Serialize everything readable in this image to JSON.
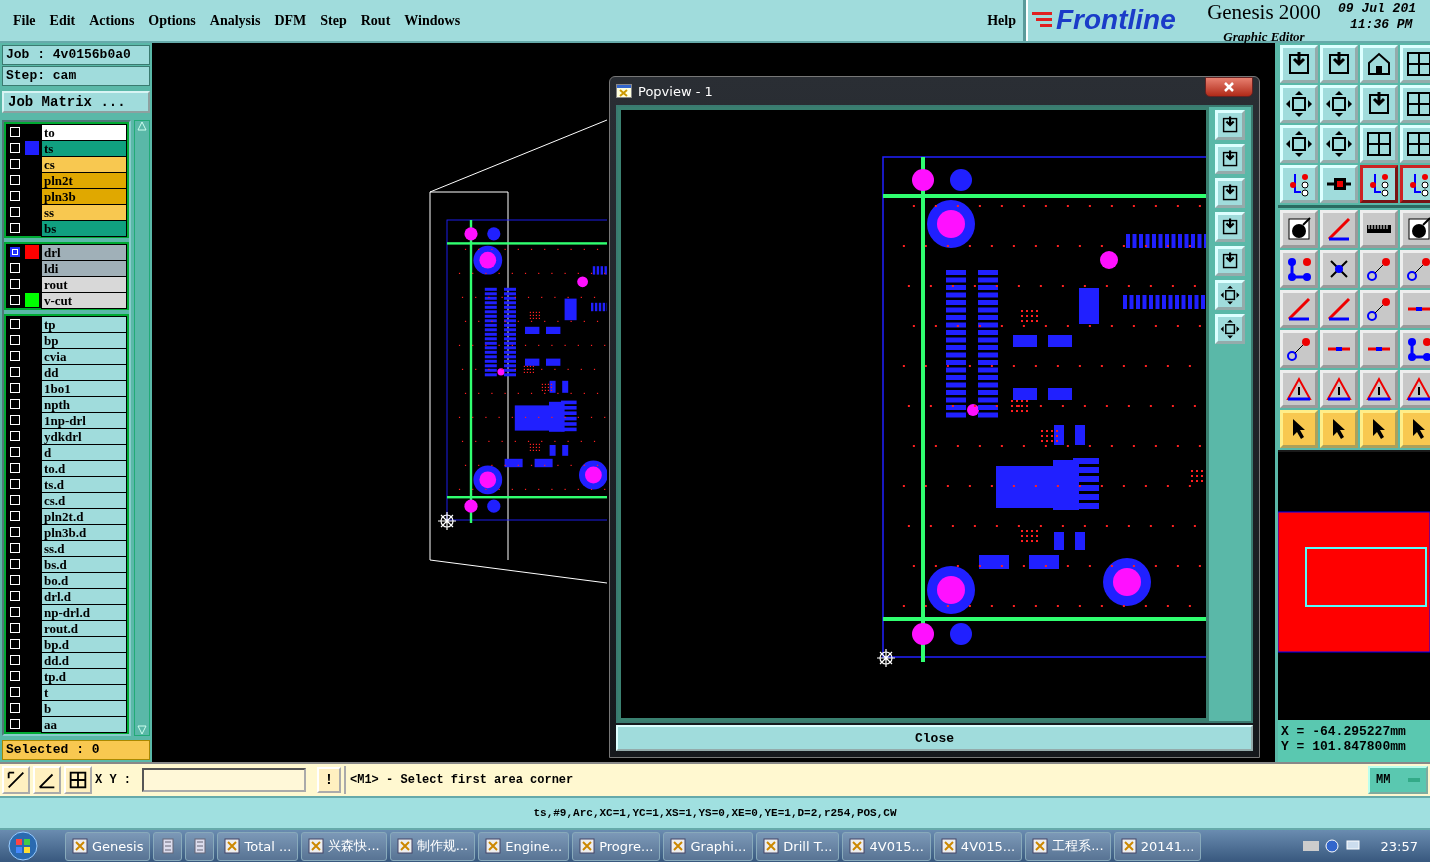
{
  "menu": {
    "items": [
      "File",
      "Edit",
      "Actions",
      "Options",
      "Analysis",
      "DFM",
      "Step",
      "Rout",
      "Windows"
    ],
    "help": "Help"
  },
  "logo": {
    "brand": "Frontline",
    "product": "Genesis 2000",
    "subtitle": "Graphic Editor"
  },
  "clock": {
    "date": "09 Jul 201",
    "time": "11:36 PM"
  },
  "job_panel": {
    "job": "Job : 4v0156b0a0",
    "step": "Step: cam",
    "matrix_button": "Job Matrix ...",
    "selected": "Selected : 0",
    "layer_groups": [
      [
        {
          "name": "to",
          "kind": "silk",
          "affected": false
        },
        {
          "name": "ts",
          "kind": "mask",
          "affected": false,
          "color": "#2020ff"
        },
        {
          "name": "cs",
          "kind": "signal",
          "affected": false
        },
        {
          "name": "pln2t",
          "kind": "plane",
          "affected": false
        },
        {
          "name": "pln3b",
          "kind": "plane",
          "affected": false
        },
        {
          "name": "ss",
          "kind": "signal",
          "affected": false
        },
        {
          "name": "bs",
          "kind": "mask",
          "affected": false
        }
      ],
      [
        {
          "name": "drl",
          "kind": "drill",
          "affected": true,
          "color": "#ff0000"
        },
        {
          "name": "ldi",
          "kind": "drill",
          "affected": false
        },
        {
          "name": "rout",
          "kind": "rout",
          "affected": false
        },
        {
          "name": "v-cut",
          "kind": "rout",
          "affected": false,
          "color": "#00ff00"
        }
      ],
      [
        {
          "name": "tp",
          "kind": "document",
          "affected": false
        },
        {
          "name": "bp",
          "kind": "document",
          "affected": false
        },
        {
          "name": "cvia",
          "kind": "document",
          "affected": false
        },
        {
          "name": "dd",
          "kind": "document",
          "affected": false
        },
        {
          "name": "1bo1",
          "kind": "document",
          "affected": false
        },
        {
          "name": "npth",
          "kind": "document",
          "affected": false
        },
        {
          "name": "1np-drl",
          "kind": "document",
          "affected": false
        },
        {
          "name": "ydkdrl",
          "kind": "document",
          "affected": false
        },
        {
          "name": "d",
          "kind": "document",
          "affected": false
        },
        {
          "name": "to.d",
          "kind": "document",
          "affected": false
        },
        {
          "name": "ts.d",
          "kind": "document",
          "affected": false
        },
        {
          "name": "cs.d",
          "kind": "document",
          "affected": false
        },
        {
          "name": "pln2t.d",
          "kind": "document",
          "affected": false
        },
        {
          "name": "pln3b.d",
          "kind": "document",
          "affected": false
        },
        {
          "name": "ss.d",
          "kind": "document",
          "affected": false
        },
        {
          "name": "bs.d",
          "kind": "document",
          "affected": false
        },
        {
          "name": "bo.d",
          "kind": "document",
          "affected": false
        },
        {
          "name": "drl.d",
          "kind": "document",
          "affected": false
        },
        {
          "name": "np-drl.d",
          "kind": "document",
          "affected": false
        },
        {
          "name": "rout.d",
          "kind": "document",
          "affected": false
        },
        {
          "name": "bp.d",
          "kind": "document",
          "affected": false
        },
        {
          "name": "dd.d",
          "kind": "document",
          "affected": false
        },
        {
          "name": "tp.d",
          "kind": "document",
          "affected": false
        },
        {
          "name": "t",
          "kind": "document",
          "affected": false
        },
        {
          "name": "b",
          "kind": "document",
          "affected": false
        },
        {
          "name": "aa",
          "kind": "document",
          "affected": false
        }
      ]
    ]
  },
  "popview": {
    "title": "Popview - 1",
    "close_button": "Close"
  },
  "coordinates": {
    "x": "X = -64.295227mm",
    "y": "Y = 101.847800mm"
  },
  "input_bar": {
    "xy_label": "X Y :",
    "alert_button": "!",
    "message": "<M1> - Select first area corner",
    "units": "MM"
  },
  "command_line": "ts,#9,Arc,XC=1,YC=1,XS=1,YS=0,XE=0,YE=1,D=2,r254,POS,CW",
  "taskbar": {
    "items": [
      {
        "kind": "app",
        "label": "Genesis"
      },
      {
        "kind": "icon"
      },
      {
        "kind": "icon"
      },
      {
        "kind": "app",
        "label": "Total ..."
      },
      {
        "kind": "app",
        "label": "兴森快..."
      },
      {
        "kind": "app",
        "label": "制作规..."
      },
      {
        "kind": "app",
        "label": "Engine..."
      },
      {
        "kind": "app",
        "label": "Progre..."
      },
      {
        "kind": "app",
        "label": "Graphi..."
      },
      {
        "kind": "app",
        "label": "Drill T..."
      },
      {
        "kind": "app",
        "label": "4V015..."
      },
      {
        "kind": "app",
        "label": "4V015..."
      },
      {
        "kind": "app",
        "label": "工程系..."
      },
      {
        "kind": "app",
        "label": "20141..."
      }
    ],
    "time": "23:57"
  }
}
